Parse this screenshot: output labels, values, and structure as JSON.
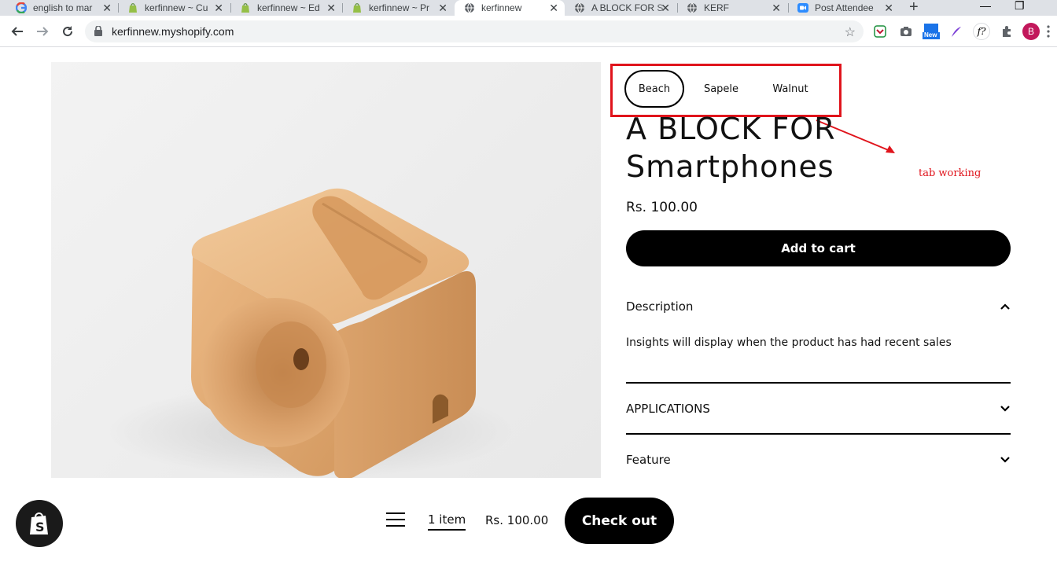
{
  "browser": {
    "tabs": [
      {
        "title": "english to mar",
        "icon": "google-icon"
      },
      {
        "title": "kerfinnew ~ Cu",
        "icon": "shopify-icon"
      },
      {
        "title": "kerfinnew ~ Ed",
        "icon": "shopify-icon"
      },
      {
        "title": "kerfinnew ~ Pr",
        "icon": "shopify-icon"
      },
      {
        "title": "kerfinnew",
        "icon": "globe-icon",
        "active": true
      },
      {
        "title": "A BLOCK FOR S",
        "icon": "globe-icon"
      },
      {
        "title": "KERF",
        "icon": "globe-icon"
      },
      {
        "title": "Post Attendee",
        "icon": "zoom-icon"
      }
    ],
    "new_tab_label": "+",
    "url": "kerfinnew.myshopify.com",
    "profile_initial": "B",
    "extension_new_badge": "New",
    "extension_f_label": "f?"
  },
  "product": {
    "image_alt": "Wooden phone block",
    "variants": [
      {
        "label": "Beach",
        "selected": true
      },
      {
        "label": "Sapele",
        "selected": false
      },
      {
        "label": "Walnut",
        "selected": false
      }
    ],
    "title_line1": "A BLOCK FOR",
    "title_line2": "Smartphones",
    "price": "Rs. 100.00",
    "add_to_cart": "Add to cart",
    "accordion": [
      {
        "title": "Description",
        "expanded": true,
        "body": "Insights will display when the product has had recent sales"
      },
      {
        "title": "APPLICATIONS",
        "expanded": false
      },
      {
        "title": "Feature",
        "expanded": false
      }
    ]
  },
  "annotation": {
    "note": "tab working",
    "color": "#e0141c"
  },
  "sticky_bar": {
    "item_count": "1 item",
    "price": "Rs. 100.00",
    "checkout": "Check out"
  }
}
